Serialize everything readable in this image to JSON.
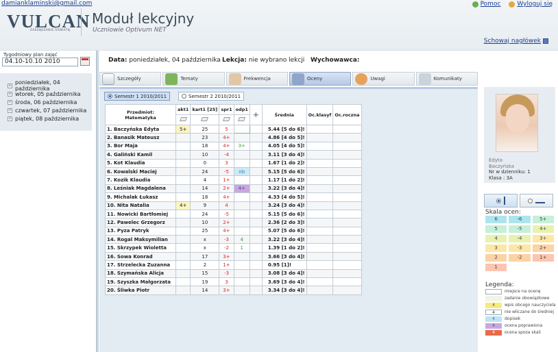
{
  "header": {
    "email": "damianklaminski@gmail.com",
    "logo": "VULCAN",
    "logo_sub": "ZARZĄDZANIE OŚWIATĄ",
    "title": "Moduł lekcyjny",
    "subtitle": "Uczniowie Optivum NET",
    "help": "Pomoc",
    "logout": "Wyloguj się",
    "hide_header": "Schowaj nagłówek"
  },
  "left": {
    "week_label": "Tygodniowy plan zajęć",
    "week_value": "04.10-10.10 2010",
    "days": [
      "poniedziałek, 04 października",
      "wtorek, 05 października",
      "środa, 06 października",
      "czwartek, 07 października",
      "piątek, 08 października"
    ]
  },
  "info": {
    "data_label": "Data:",
    "data_value": "poniedziałek, 04 października",
    "lekcja_label": "Lekcja:",
    "lekcja_value": "nie wybrano lekcji",
    "wych_label": "Wychowawca:"
  },
  "tabs": [
    "Szczegóły",
    "Tematy",
    "Frekwencja",
    "Oceny",
    "Uwagi",
    "Komunikaty"
  ],
  "semesters": [
    "Semestr 1 2010/2011",
    "Semestr 2 2010/2011"
  ],
  "table": {
    "subject_header": "Przedmiot:",
    "subject_name": "Matematyka",
    "columns": [
      "akt1",
      "kart1 [25]",
      "spr1",
      "odp1"
    ],
    "avg_header": "Średnia",
    "klasyf_header": "Oc.klasyf",
    "roczna_header": "Oc.roczna",
    "rows": [
      {
        "name": "1. Baczyńska Edyta",
        "akt1": "5+",
        "kart1": "25",
        "spr1": "5",
        "odp1": "",
        "avg": "5.44 [5 do 6]!"
      },
      {
        "name": "2. Banasik Mateusz",
        "akt1": "",
        "kart1": "23",
        "spr1": "4+",
        "odp1": "",
        "avg": "4.86 [4 do 5]!"
      },
      {
        "name": "3. Bor Maja",
        "akt1": "",
        "kart1": "18",
        "spr1": "4+",
        "odp1": "3+",
        "avg": "4.05 [4 do 5]!"
      },
      {
        "name": "4. Galiński Kamil",
        "akt1": "",
        "kart1": "10",
        "spr1": "-4",
        "odp1": "",
        "avg": "3.11 [3 do 4]!"
      },
      {
        "name": "5. Kot Klaudia",
        "akt1": "",
        "kart1": "0",
        "spr1": "3",
        "odp1": "",
        "avg": "1.67 [1 do 2]!"
      },
      {
        "name": "6. Kowalski Maciej",
        "akt1": "",
        "kart1": "24",
        "spr1": "-5",
        "odp1": "nb",
        "avg": "5.15 [5 do 6]!"
      },
      {
        "name": "7. Kozik Klaudia",
        "akt1": "",
        "kart1": "4",
        "spr1": "1+",
        "odp1": "",
        "avg": "1.17 [1 do 2]!"
      },
      {
        "name": "8. Leśniak Magdalena",
        "akt1": "",
        "kart1": "14",
        "spr1": "2+",
        "odp1": "4+",
        "avg": "3.22 [3 do 4]!"
      },
      {
        "name": "9. Michalak Łukasz",
        "akt1": "",
        "kart1": "18",
        "spr1": "4+",
        "odp1": "",
        "avg": "4.33 [4 do 5]!"
      },
      {
        "name": "10. Nita Natalia",
        "akt1": "4+",
        "kart1": "9",
        "spr1": "4",
        "odp1": "",
        "avg": "3.24 [3 do 4]!"
      },
      {
        "name": "11. Nowicki Bartłomiej",
        "akt1": "",
        "kart1": "24",
        "spr1": "-5",
        "odp1": "",
        "avg": "5.15 [5 do 6]!"
      },
      {
        "name": "12. Pawelec Grzegorz",
        "akt1": "",
        "kart1": "10",
        "spr1": "2+",
        "odp1": "",
        "avg": "2.36 [2 do 3]!"
      },
      {
        "name": "13. Pyza Patryk",
        "akt1": "",
        "kart1": "25",
        "spr1": "4+",
        "odp1": "",
        "avg": "5.07 [5 do 6]!"
      },
      {
        "name": "14. Rogal Maksymilian",
        "akt1": "",
        "kart1": "x",
        "spr1": "-3",
        "odp1": "4",
        "avg": "3.22 [3 do 4]!"
      },
      {
        "name": "15. Skrzypek Wioletta",
        "akt1": "",
        "kart1": "x",
        "spr1": "-2",
        "odp1": "1",
        "avg": "1.39 [1 do 2]!"
      },
      {
        "name": "16. Sowa Konrad",
        "akt1": "",
        "kart1": "17",
        "spr1": "3+",
        "odp1": "",
        "avg": "3.66 [3 do 4]!"
      },
      {
        "name": "17. Strzelecka Zuzanna",
        "akt1": "",
        "kart1": "2",
        "spr1": "1+",
        "odp1": "",
        "avg": "0.95 [1]!"
      },
      {
        "name": "18. Szymańska Alicja",
        "akt1": "",
        "kart1": "15",
        "spr1": "-3",
        "odp1": "",
        "avg": "3.08 [3 do 4]!"
      },
      {
        "name": "19. Szyszka Małgorzata",
        "akt1": "",
        "kart1": "19",
        "spr1": "3",
        "odp1": "",
        "avg": "3.69 [3 do 4]!"
      },
      {
        "name": "20. Śliwka Piotr",
        "akt1": "",
        "kart1": "14",
        "spr1": "3+",
        "odp1": "",
        "avg": "3.34 [3 do 4]!"
      }
    ]
  },
  "student": {
    "first": "Edyta",
    "last": "Baczyńska",
    "nr": "Nr w dzienniku:  1",
    "klasa": "Klasa :  3A"
  },
  "skala": {
    "title": "Skala ocen:",
    "grades": [
      "6",
      "-6",
      "5+",
      "5",
      "-5",
      "4+",
      "4",
      "-4",
      "3+",
      "3",
      "-3",
      "2+",
      "2",
      "-2",
      "1+",
      "1"
    ]
  },
  "legend": {
    "title": "Legenda:",
    "items": [
      {
        "sw": "",
        "label": "miejsce na ocenę"
      },
      {
        "sw": "",
        "label": "zadanie obowiązkowe"
      },
      {
        "sw": "4",
        "label": "wpis obcego nauczyciela"
      },
      {
        "sw": "4",
        "label": "nie wliczane do średniej"
      },
      {
        "sw": "4",
        "label": "dopisek"
      },
      {
        "sw": "4",
        "label": "ocena poprawiona"
      },
      {
        "sw": "4",
        "label": "ocena spoza skali"
      }
    ]
  }
}
